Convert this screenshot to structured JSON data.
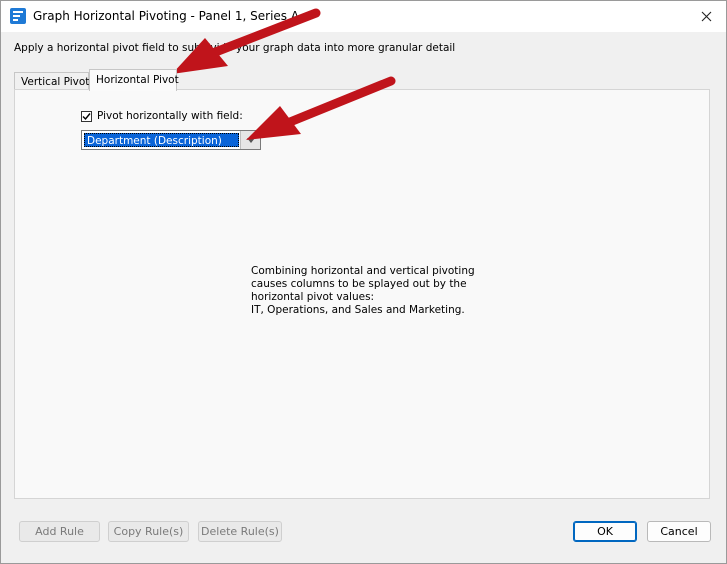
{
  "window": {
    "title": "Graph Horizontal Pivoting - Panel 1, Series A",
    "icon": "graph-app-icon",
    "close_glyph": "✕"
  },
  "description": "Apply a horizontal pivot field to subdivide your graph data into more granular detail",
  "tabs": [
    {
      "label": "Vertical Pivot",
      "selected": false
    },
    {
      "label": "Horizontal Pivot",
      "selected": true
    }
  ],
  "pivot": {
    "checkbox_label": "Pivot horizontally with field:",
    "checked": true,
    "field_value": "Department (Description)"
  },
  "info_lines": [
    "Combining horizontal and vertical pivoting",
    "causes columns to be splayed out by the",
    "horizontal pivot values:",
    "IT, Operations, and Sales and Marketing."
  ],
  "buttons": {
    "add_rule": "Add Rule",
    "copy_rule": "Copy Rule(s)",
    "delete_rule": "Delete Rule(s)",
    "ok": "OK",
    "cancel": "Cancel"
  },
  "colors": {
    "annotation_arrow": "#c0141b",
    "selection": "#0a64d8",
    "default_button_border": "#0067c0"
  }
}
